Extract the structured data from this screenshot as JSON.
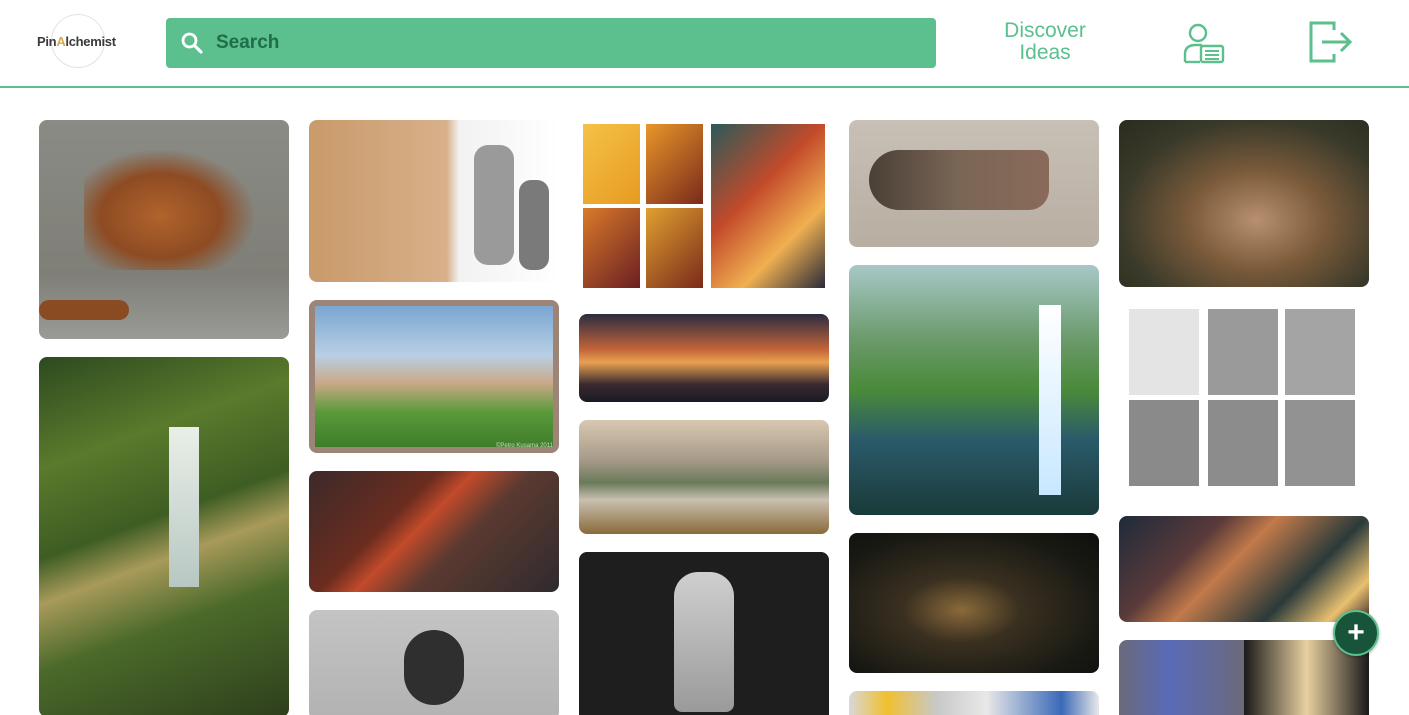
{
  "app": {
    "logo_text_pre": "Pin",
    "logo_text_accent": "A",
    "logo_text_post": "lchemist"
  },
  "search": {
    "placeholder": "Search",
    "icon": "search-icon"
  },
  "nav": {
    "discover_label": "Discover\nIdeas",
    "profile_icon": "profile-card-icon",
    "logout_icon": "logout-icon"
  },
  "fab": {
    "label": "+",
    "icon": "plus-icon"
  },
  "colors": {
    "accent": "#5bbf8e",
    "accent_dark": "#1f6e48",
    "fab": "#18543a"
  },
  "pins": {
    "p10": {
      "caption": "©Petro Kusama 2011"
    }
  }
}
